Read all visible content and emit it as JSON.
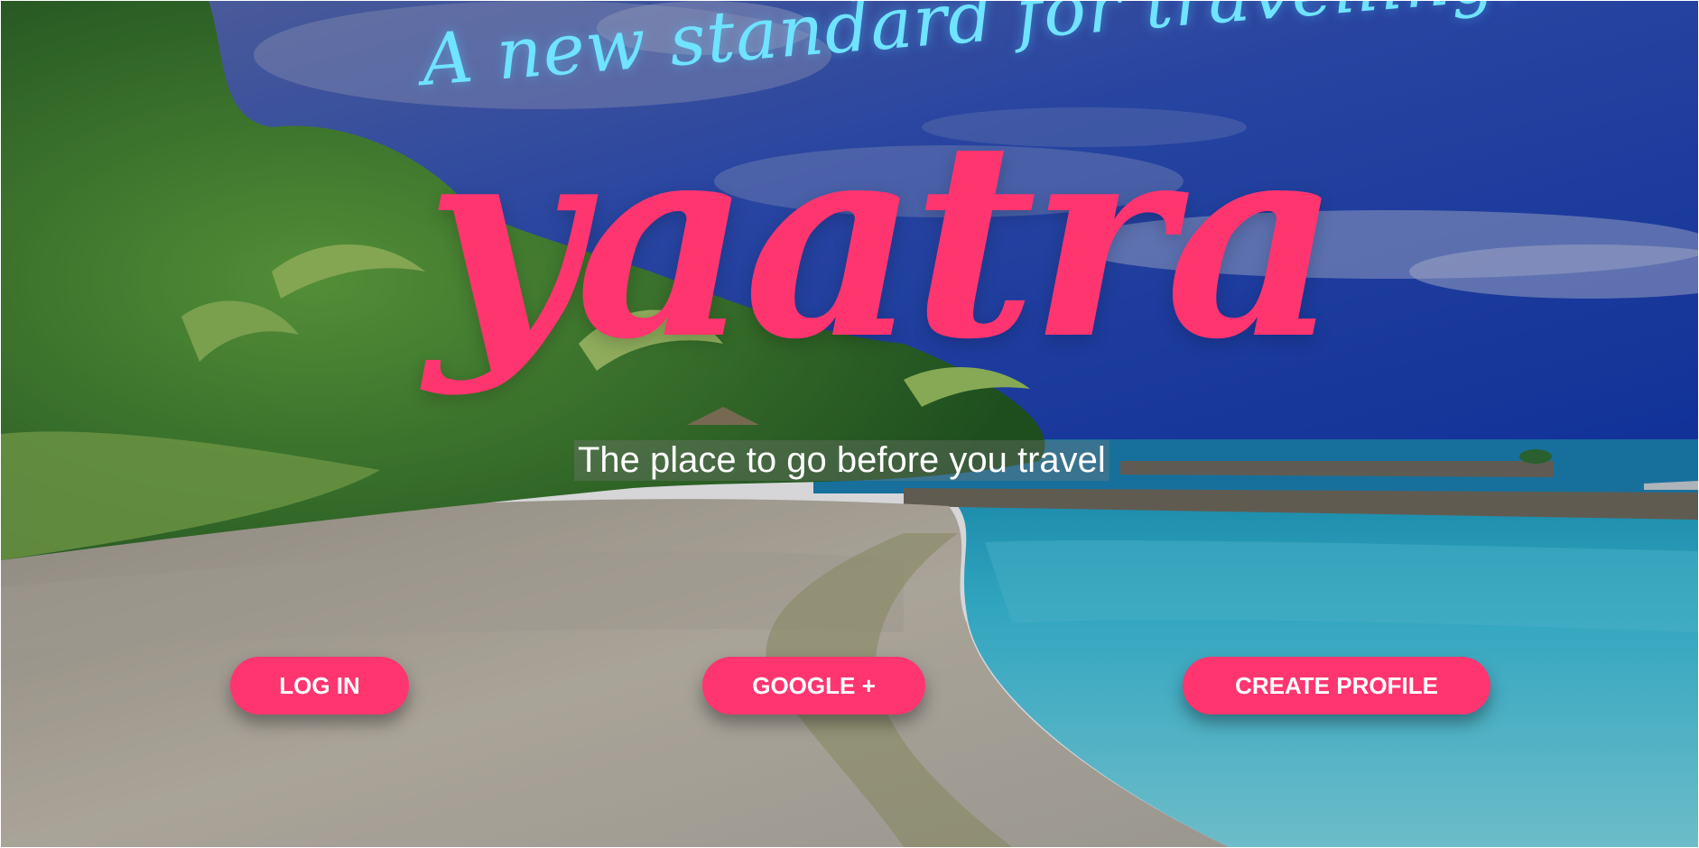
{
  "hero": {
    "tagline": "A new standard for travelling!",
    "brand": "yaatra",
    "subtitle": "The place to go before you travel"
  },
  "actions": {
    "login_label": "LOG IN",
    "google_label": "GOOGLE +",
    "create_label": "CREATE PROFILE"
  },
  "colors": {
    "accent": "#ff3570",
    "tagline": "#6fe3ff",
    "sky": "#1a3fb8",
    "sea": "#36c4e0",
    "sand": "#c9c2b0"
  }
}
